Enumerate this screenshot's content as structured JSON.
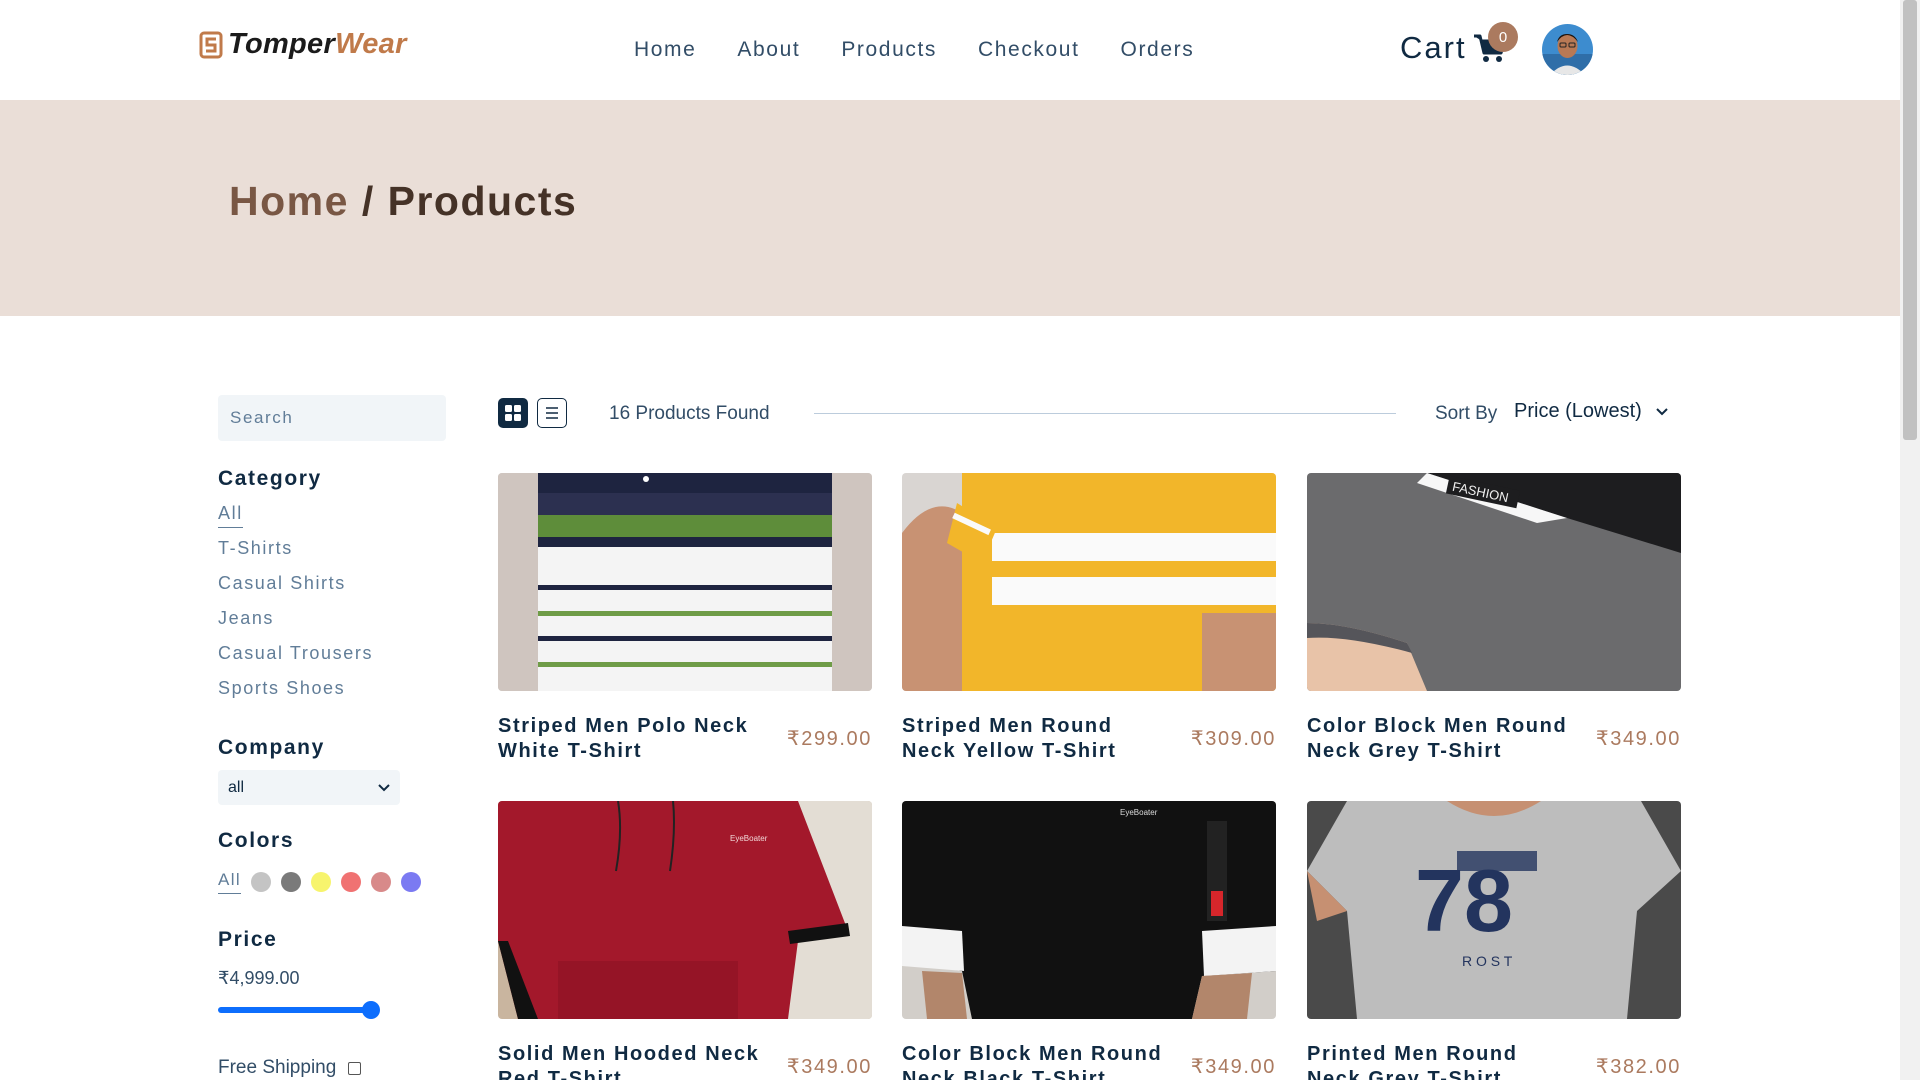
{
  "brand": {
    "name_part1": "Tomper",
    "name_part2": "Wear"
  },
  "nav": {
    "links": [
      "Home",
      "About",
      "Products",
      "Checkout",
      "Orders"
    ]
  },
  "cart": {
    "label": "Cart",
    "count": "0"
  },
  "hero": {
    "home": "Home",
    "separator": " / ",
    "current": "Products"
  },
  "filters": {
    "search_placeholder": "Search",
    "category_title": "Category",
    "categories": [
      "All",
      "T-Shirts",
      "Casual Shirts",
      "Jeans",
      "Casual Trousers",
      "Sports Shoes"
    ],
    "company_title": "Company",
    "company_selected": "all",
    "colors_title": "Colors",
    "colors_all": "All",
    "colors": [
      "#c4c4c4",
      "#7a7a7a",
      "#f7f46d",
      "#f07272",
      "#d88a8a",
      "#7b7af2"
    ],
    "price_title": "Price",
    "price_value": "₹4,999.00",
    "price_fill": 1.0,
    "free_shipping": "Free Shipping"
  },
  "products_bar": {
    "found": "16 Products Found",
    "sort_label": "Sort By",
    "sort_selected": "Price (Lowest)"
  },
  "products": [
    {
      "name": "Striped Men Polo Neck White T-Shirt",
      "price": "₹299.00"
    },
    {
      "name": "Striped Men Round Neck Yellow T-Shirt",
      "price": "₹309.00"
    },
    {
      "name": "Color Block Men Round Neck Grey T-Shirt",
      "price": "₹349.00"
    },
    {
      "name": "Solid Men Hooded Neck Red T-Shirt",
      "price": "₹349.00"
    },
    {
      "name": "Color Block Men Round Neck Black T-Shirt",
      "price": "₹349.00"
    },
    {
      "name": "Printed Men Round Neck Grey T-Shirt",
      "price": "₹382.00"
    }
  ],
  "colors": {
    "accent": "#ab7a5f",
    "dark": "#102a42",
    "hero_bg": "#eaded7",
    "slider": "#0d6efd"
  }
}
